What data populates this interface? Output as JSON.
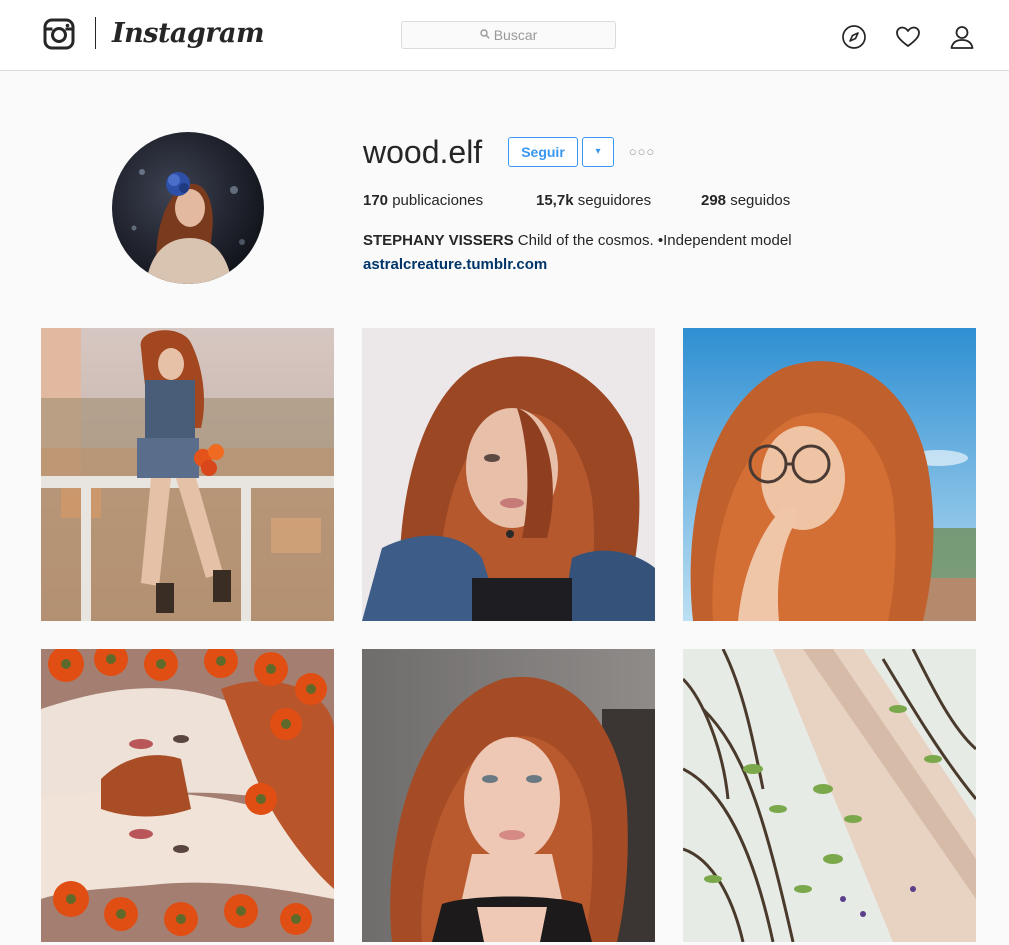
{
  "app": {
    "name": "Instagram"
  },
  "header": {
    "wordmark": "Instagram",
    "search": {
      "placeholder": "Buscar"
    },
    "icons": [
      "instagram-glyph-icon",
      "compass-icon",
      "heart-icon",
      "person-icon"
    ]
  },
  "profile": {
    "username": "wood.elf",
    "follow_label": "Seguir",
    "dropdown_glyph": "▾",
    "options_glyph": "○○○",
    "stats": [
      {
        "count": "170",
        "label": "publicaciones"
      },
      {
        "count": "15,7k",
        "label": "seguidores"
      },
      {
        "count": "298",
        "label": "seguidos"
      }
    ],
    "full_name": "STEPHANY VISSERS",
    "bio": "Child of the cosmos. •Independent model",
    "website": "astralcreature.tumblr.com"
  },
  "posts": [
    {
      "description": "woman-on-balcony-with-flowers"
    },
    {
      "description": "redhead-selfie-denim-jacket"
    },
    {
      "description": "redhead-with-glasses-blue-sky"
    },
    {
      "description": "two-redheads-orange-gerberas"
    },
    {
      "description": "redhead-portrait-gray-background"
    },
    {
      "description": "plants-and-pillar-upward-view"
    }
  ],
  "colors": {
    "accent": "#3897f0",
    "link": "#003569",
    "text": "#262626",
    "border": "#dbdbdb",
    "background": "#fafafa"
  }
}
